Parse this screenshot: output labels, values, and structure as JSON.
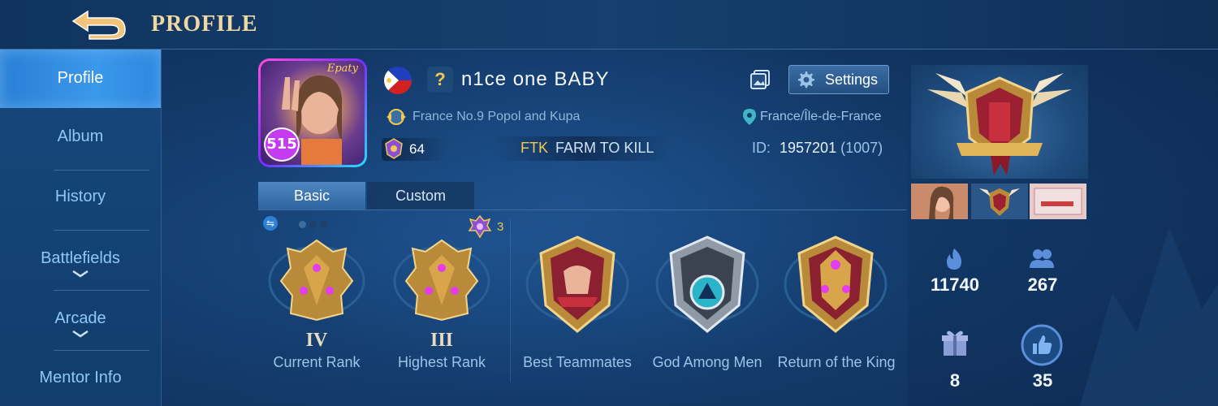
{
  "header": {
    "title": "PROFILE",
    "back_icon": "back-arrow-icon"
  },
  "sidebar": {
    "items": [
      {
        "label": "Profile",
        "active": true
      },
      {
        "label": "Album"
      },
      {
        "label": "History"
      },
      {
        "label": "Battlefields",
        "expandable": true
      },
      {
        "label": "Arcade",
        "expandable": true
      },
      {
        "label": "Mentor Info"
      }
    ]
  },
  "player": {
    "name": "n1ce one BABY",
    "unknown_badge": "?",
    "squad": "France No.9 Popol and Kupa",
    "level": "64",
    "squad_tag": "FTK",
    "squad_name": "FARM TO KILL",
    "location": "France/Île-de-France",
    "id_label": "ID:",
    "id_value": "1957201",
    "server": "(1007)",
    "avatar_badge": "515",
    "avatar_signature": "Epaty"
  },
  "header_actions": {
    "settings_label": "Settings"
  },
  "tabs": [
    {
      "label": "Basic",
      "active": true
    },
    {
      "label": "Custom"
    }
  ],
  "top_indicator": {
    "star_count": "3"
  },
  "ranks": [
    {
      "numeral": "IV",
      "label": "Current Rank"
    },
    {
      "numeral": "III",
      "label": "Highest Rank"
    }
  ],
  "achievements": [
    {
      "label": "Best Teammates"
    },
    {
      "label": "God Among Men"
    },
    {
      "label": "Return of the King"
    }
  ],
  "stats": [
    {
      "icon": "fire-icon",
      "value": "11740"
    },
    {
      "icon": "followers-icon",
      "value": "267"
    },
    {
      "icon": "gift-icon",
      "value": "8"
    },
    {
      "icon": "thumbs-up-icon",
      "value": "35"
    }
  ],
  "colors": {
    "gold": "#f2c94c",
    "accent_blue": "#3b98ea",
    "label_blue": "#9cc3e8"
  }
}
